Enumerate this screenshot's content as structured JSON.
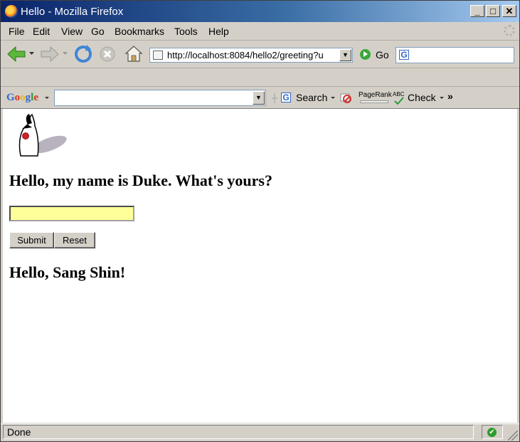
{
  "window": {
    "title": "Hello - Mozilla Firefox"
  },
  "menu": {
    "file": "File",
    "edit": "Edit",
    "view": "View",
    "go": "Go",
    "bookmarks": "Bookmarks",
    "tools": "Tools",
    "help": "Help"
  },
  "nav": {
    "url": "http://localhost:8084/hello2/greeting?u",
    "go_label": "Go"
  },
  "google_toolbar": {
    "logo": "Google",
    "search_label": "Search",
    "pagerank_label": "PageRank",
    "abc_label": "ABC",
    "check_label": "Check",
    "more": "»"
  },
  "page": {
    "heading": "Hello, my name is Duke. What's yours?",
    "name_value": "",
    "submit_label": "Submit",
    "reset_label": "Reset",
    "greeting": "Hello, Sang Shin!"
  },
  "status": {
    "text": "Done"
  },
  "colors": {
    "input_bg": "#ffff99",
    "title_gradient_start": "#0a246a",
    "title_gradient_end": "#a6caf0"
  }
}
